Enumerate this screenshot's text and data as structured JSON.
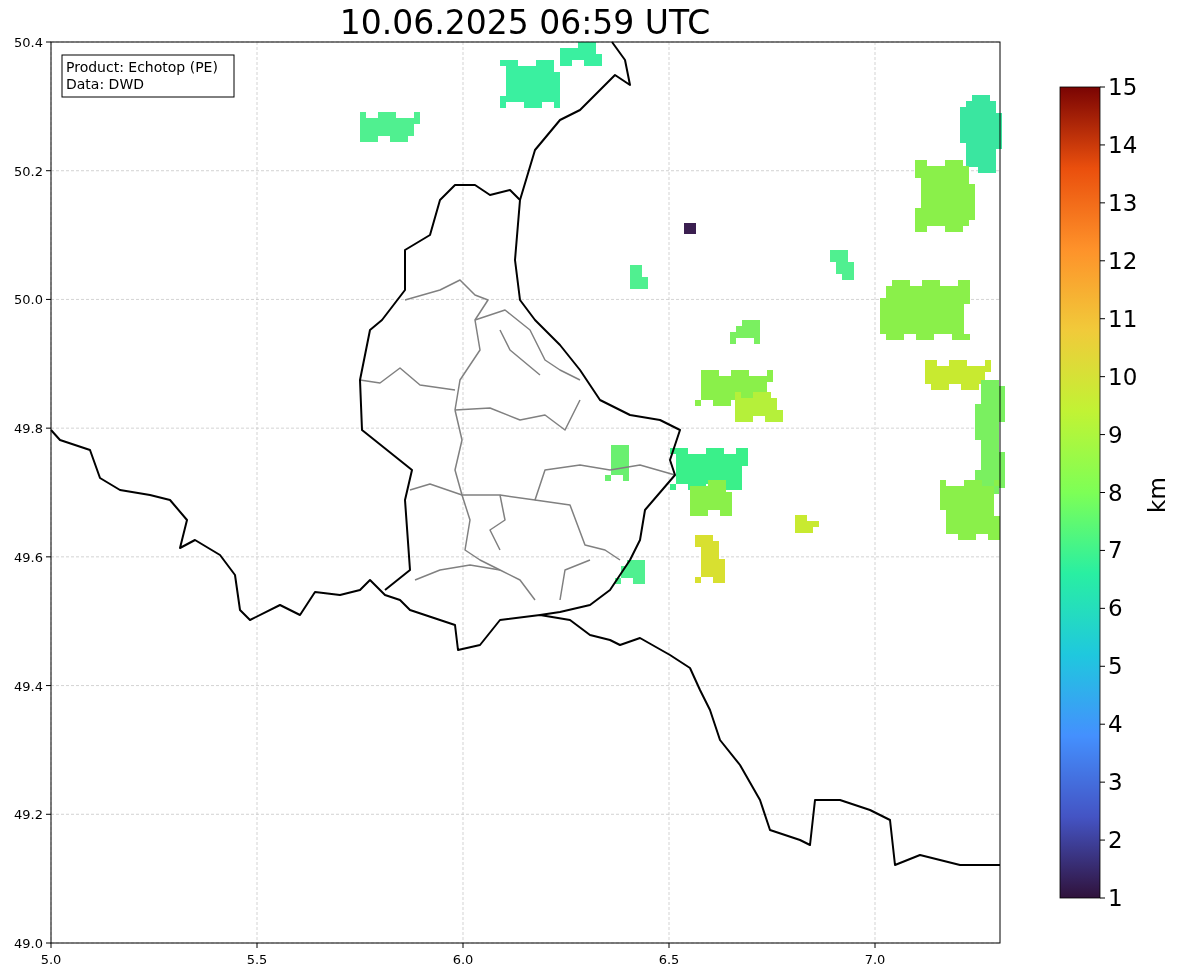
{
  "title": "10.06.2025 06:59 UTC",
  "legend": [
    "Product: Echotop (PE)",
    "Data: DWD"
  ],
  "x_ticks": [
    "5.0",
    "5.5",
    "6.0",
    "6.5",
    "7.0"
  ],
  "y_ticks": [
    "50.4",
    "50.2",
    "50.0",
    "49.8",
    "49.6",
    "49.4",
    "49.2",
    "49.0"
  ],
  "colorbar": {
    "label": "km",
    "ticks": [
      "15",
      "14",
      "13",
      "12",
      "11",
      "10",
      "9",
      "8",
      "7",
      "6",
      "5",
      "4",
      "3",
      "2",
      "1"
    ]
  }
}
